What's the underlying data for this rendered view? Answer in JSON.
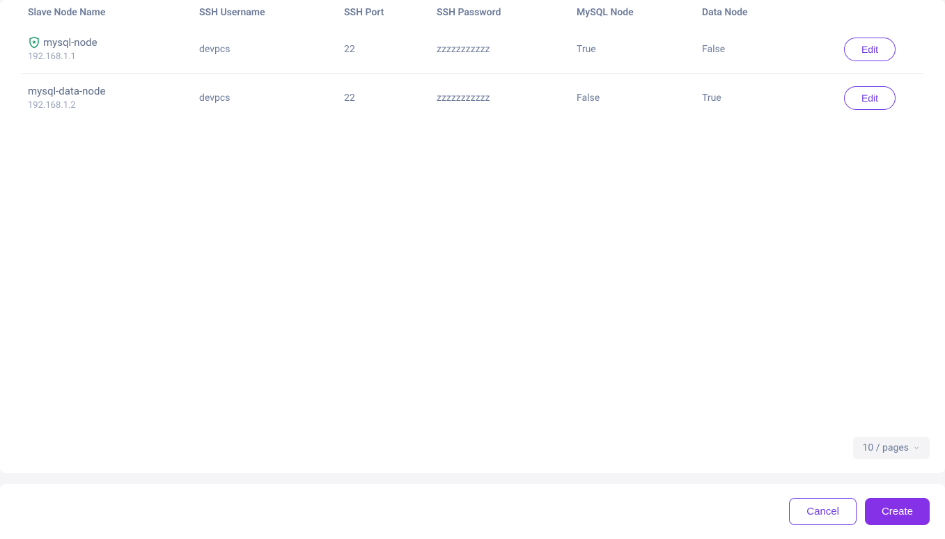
{
  "table": {
    "headers": {
      "name": "Slave Node Name",
      "user": "SSH Username",
      "port": "SSH Port",
      "pass": "SSH Password",
      "mysql": "MySQL Node",
      "data": "Data Node"
    },
    "rows": [
      {
        "has_shield": true,
        "name": "mysql-node",
        "ip": "192.168.1.1",
        "user": "devpcs",
        "port": "22",
        "pass": "zzzzzzzzzzz",
        "mysql": "True",
        "data": "False",
        "action": "Edit"
      },
      {
        "has_shield": false,
        "name": "mysql-data-node",
        "ip": "192.168.1.2",
        "user": "devpcs",
        "port": "22",
        "pass": "zzzzzzzzzzz",
        "mysql": "False",
        "data": "True",
        "action": "Edit"
      }
    ]
  },
  "pagination": {
    "page_size_label": "10 / pages"
  },
  "footer": {
    "cancel": "Cancel",
    "create": "Create"
  }
}
